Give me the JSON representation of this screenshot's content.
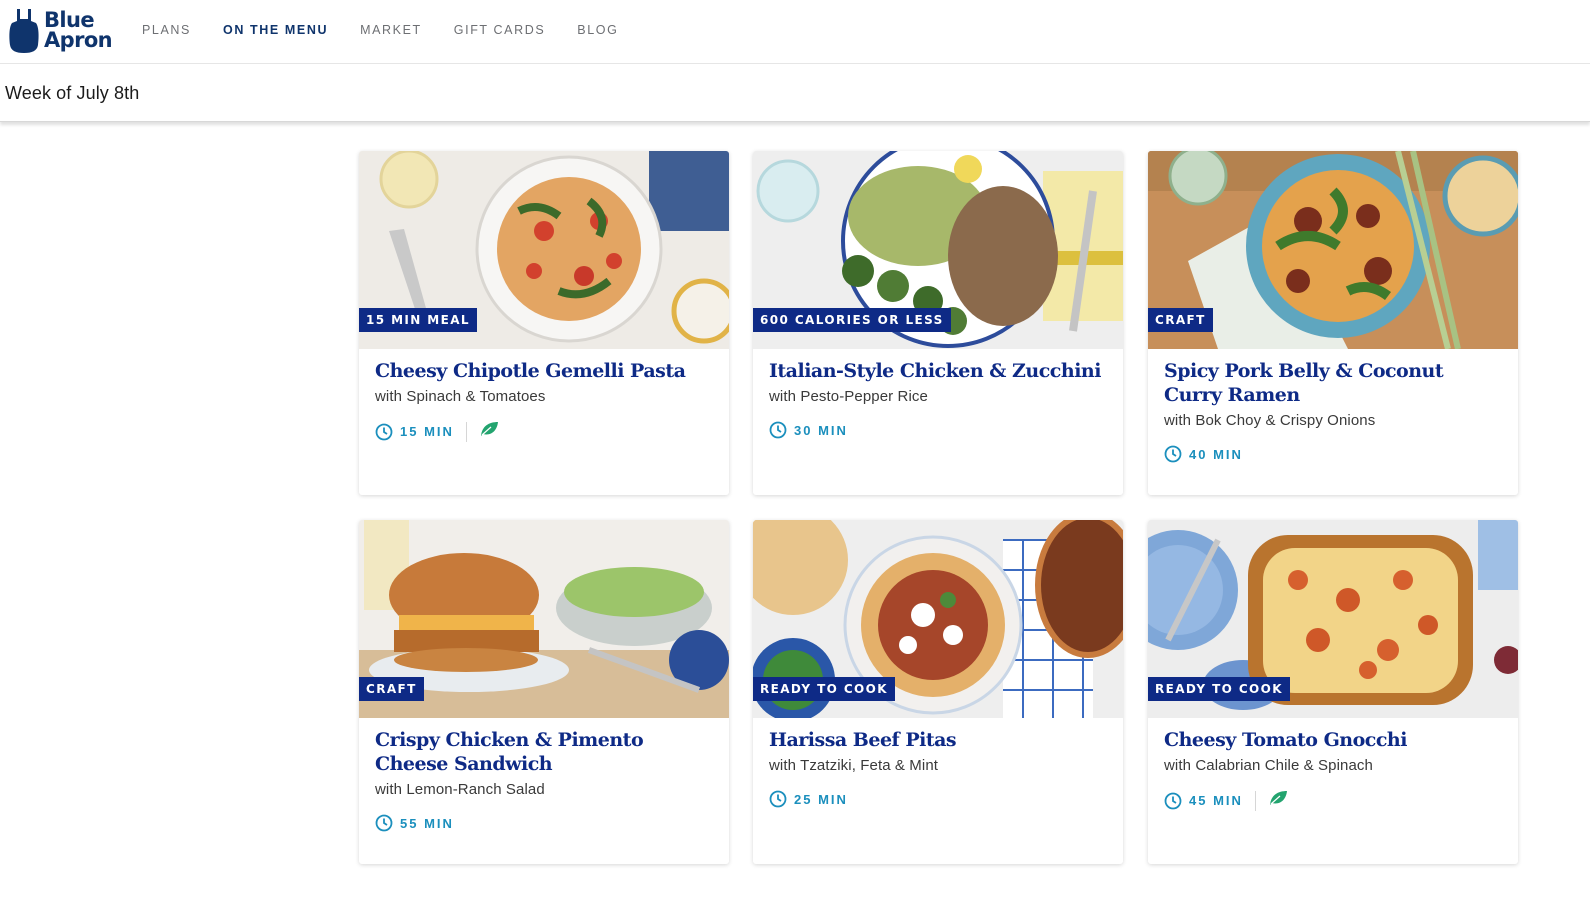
{
  "brand": {
    "name": "Blue\nApron"
  },
  "nav": [
    {
      "label": "PLANS",
      "active": false
    },
    {
      "label": "ON THE MENU",
      "active": true
    },
    {
      "label": "MARKET",
      "active": false
    },
    {
      "label": "GIFT CARDS",
      "active": false
    },
    {
      "label": "BLOG",
      "active": false
    }
  ],
  "week": {
    "label": "Week of July 8th"
  },
  "colors": {
    "brand": "#0e2a86",
    "time": "#1b8fbd",
    "leaf": "#23a46f"
  },
  "recipes": [
    {
      "badge": "15 MIN MEAL",
      "title": "Cheesy Chipotle Gemelli Pasta",
      "subtitle": "with Spinach & Tomatoes",
      "time": "15 MIN",
      "vegetarian": true,
      "icon": "pasta-bowl"
    },
    {
      "badge": "600 CALORIES OR LESS",
      "title": "Italian-Style Chicken & Zucchini",
      "subtitle": "with Pesto-Pepper Rice",
      "time": "30 MIN",
      "vegetarian": false,
      "icon": "chicken-plate"
    },
    {
      "badge": "CRAFT",
      "title": "Spicy Pork Belly & Coconut Curry Ramen",
      "subtitle": "with Bok Choy & Crispy Onions",
      "time": "40 MIN",
      "vegetarian": false,
      "icon": "ramen-bowl"
    },
    {
      "badge": "CRAFT",
      "title": "Crispy Chicken & Pimento Cheese Sandwich",
      "subtitle": "with Lemon-Ranch Salad",
      "time": "55 MIN",
      "vegetarian": false,
      "icon": "sandwich"
    },
    {
      "badge": "READY TO COOK",
      "title": "Harissa Beef Pitas",
      "subtitle": "with Tzatziki, Feta & Mint",
      "time": "25 MIN",
      "vegetarian": false,
      "icon": "pita"
    },
    {
      "badge": "READY TO COOK",
      "title": "Cheesy Tomato Gnocchi",
      "subtitle": "with Calabrian Chile & Spinach",
      "time": "45 MIN",
      "vegetarian": true,
      "icon": "gnocchi-dish"
    }
  ]
}
